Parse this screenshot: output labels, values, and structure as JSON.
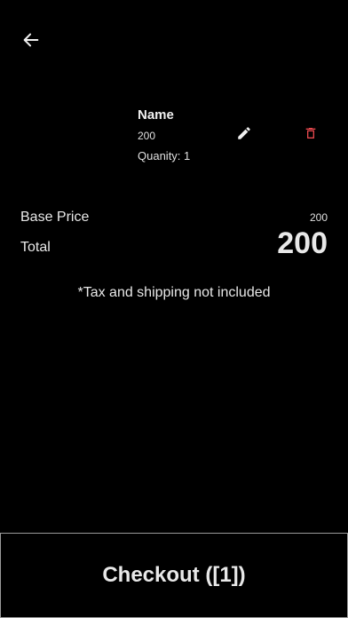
{
  "header": {
    "back_icon": "arrow-left-icon"
  },
  "cart_item": {
    "name": "Name",
    "price": "200",
    "quantity": "Quanity: 1",
    "edit_icon": "pencil-icon",
    "delete_icon": "trash-icon"
  },
  "summary": {
    "base_price_label": "Base Price",
    "base_price_value": "200",
    "total_label": "Total",
    "total_value": "200",
    "note": "*Tax and shipping not included"
  },
  "checkout": {
    "label": "Checkout ([1])"
  },
  "colors": {
    "background": "#000000",
    "text": "#e8e8e8",
    "delete_accent": "#e5484d",
    "button_border": "#9a9a9a"
  }
}
